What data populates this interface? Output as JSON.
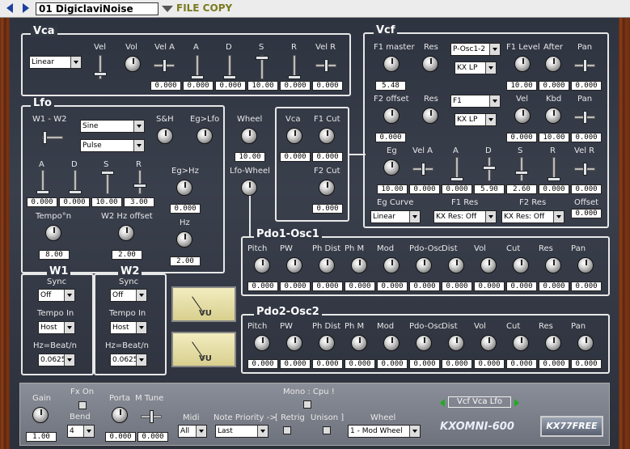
{
  "topbar": {
    "preset": "01 DigiclaviNoise",
    "file_copy": "FILE COPY"
  },
  "vca": {
    "title": "Vca",
    "mode": "Linear",
    "vel": "Vel",
    "vol": "Vol",
    "vel_a": "Vel A",
    "a": "A",
    "d": "D",
    "s": "S",
    "r": "R",
    "vel_r": "Vel R",
    "values": [
      "0.000",
      "0.000",
      "0.000",
      "10.00",
      "0.000",
      "0.000"
    ]
  },
  "lfo": {
    "title": "Lfo",
    "w1w2": "W1 - W2",
    "wave1": "Sine",
    "wave2": "Pulse",
    "sh": "S&H",
    "eglfo": "Eg>Lfo",
    "a": "A",
    "d": "D",
    "s": "S",
    "r": "R",
    "adsr_values": [
      "0.000",
      "0.000",
      "10.00",
      "3.00"
    ],
    "eghz": "Eg>Hz",
    "eghz_value": "0.000",
    "tempo": "Tempo°n",
    "tempo_value": "8.00",
    "w2hz": "W2 Hz offset",
    "w2hz_value": "2.00",
    "hz": "Hz",
    "hz_value": "2.00"
  },
  "wheel": {
    "label": "Wheel",
    "value": "10.00",
    "lfo_wheel": "Lfo-Wheel"
  },
  "mod": {
    "vca": "Vca",
    "vca_value": "0.000",
    "f1cut": "F1 Cut",
    "f1cut_value": "0.000",
    "f2cut": "F2 Cut",
    "f2cut_value": "0.000"
  },
  "vcf": {
    "title": "Vcf",
    "f1master": "F1 master",
    "f1master_value": "5.48",
    "res": "Res",
    "f1type": "P-Osc1-2",
    "f1filter": "KX LP",
    "f1level": "F1 Level",
    "after": "After",
    "pan": "Pan",
    "row1_values": [
      "10.00",
      "0.000",
      "0.000"
    ],
    "f2offset": "F2 offset",
    "f2offset_value": "0.000",
    "f2type": "F1",
    "f2filter": "KX LP",
    "vel": "Vel",
    "kbd": "Kbd",
    "row2_values": [
      "0.000",
      "10.00",
      "0.000"
    ],
    "eg": "Eg",
    "vel_a": "Vel A",
    "a": "A",
    "d": "D",
    "s": "S",
    "r": "R",
    "vel_r": "Vel R",
    "eg_values": [
      "10.00",
      "0.000",
      "0.000",
      "5.90",
      "2.60",
      "0.000",
      "0.000"
    ],
    "egcurve": "Eg Curve",
    "egcurve_value": "Linear",
    "f1res": "F1 Res",
    "f1res_value": "KX Res: Off",
    "f2res": "F2 Res",
    "f2res_value": "KX Res: Off",
    "offset": "Offset",
    "offset_value": "0.000"
  },
  "pdo1": {
    "title": "Pdo1-Osc1",
    "labels": [
      "Pitch",
      "PW",
      "Ph Dist",
      "Ph M",
      "Mod",
      "Pdo-Osc",
      "Dist",
      "Vol",
      "Cut",
      "Res",
      "Pan"
    ],
    "values": [
      "0.000",
      "0.000",
      "0.000",
      "0.000",
      "0.000",
      "0.000",
      "0.000",
      "0.000",
      "0.000",
      "0.000",
      "0.000"
    ]
  },
  "pdo2": {
    "title": "Pdo2-Osc2",
    "labels": [
      "Pitch",
      "PW",
      "Ph Dist",
      "Ph M",
      "Mod",
      "Pdo-Osc",
      "Dist",
      "Vol",
      "Cut",
      "Res",
      "Pan"
    ],
    "values": [
      "0.000",
      "0.000",
      "0.000",
      "0.000",
      "0.000",
      "0.000",
      "0.000",
      "0.000",
      "0.000",
      "0.000",
      "0.000"
    ]
  },
  "w1": {
    "title": "W1",
    "sync": "Sync",
    "sync_value": "Off",
    "tempo_in": "Tempo In",
    "tempo_in_value": "Host",
    "hz_beat": "Hz=Beat/n",
    "hz_beat_value": "0.0625"
  },
  "w2": {
    "title": "W2",
    "sync": "Sync",
    "sync_value": "Off",
    "tempo_in": "Tempo In",
    "tempo_in_value": "Host",
    "hz_beat": "Hz=Beat/n",
    "hz_beat_value": "0.0625"
  },
  "vu": {
    "label1": "VU",
    "label2": "VU"
  },
  "bottom": {
    "gain": "Gain",
    "gain_value": "1.00",
    "fxon": "Fx On",
    "bend": "Bend",
    "bend_value": "4",
    "porta": "Porta",
    "porta_value": "0.000",
    "mtune": "M Tune",
    "mtune_value": "0.000",
    "midi": "Midi",
    "midi_value": "All",
    "note_priority": "Note Priority ->",
    "note_priority_value": "Last",
    "retrig": "[ Retrig",
    "unison": "Unison ]",
    "mono_cpu": "Mono : Cpu !",
    "wheel": "Wheel",
    "wheel_value": "1 - Mod Wheel",
    "page": "Vcf Vca Lfo",
    "brand": "KXOMNI-600",
    "badge": "KX77FREE"
  }
}
